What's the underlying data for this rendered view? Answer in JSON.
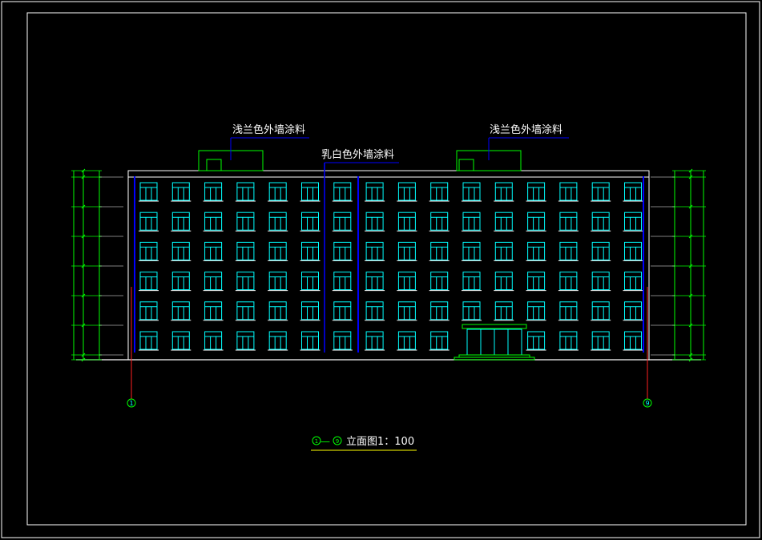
{
  "labels": {
    "left_note": "浅兰色外墙涂料",
    "right_note": "浅兰色外墙涂料",
    "center_note": "乳白色外墙涂料"
  },
  "axes": {
    "left": "1",
    "right": "9"
  },
  "title": {
    "prefix_from": "1",
    "dash": "—",
    "prefix_to": "9",
    "text": "立面图1：100"
  },
  "grid": {
    "floors": 6,
    "bays": 16
  },
  "colors": {
    "background": "#000000",
    "frame": "#ffffff",
    "window": "#00ffff",
    "dimension": "#00ff00",
    "axis_line": "#ff2020",
    "leader": "#0000ff",
    "entrance": "#00ff00"
  }
}
